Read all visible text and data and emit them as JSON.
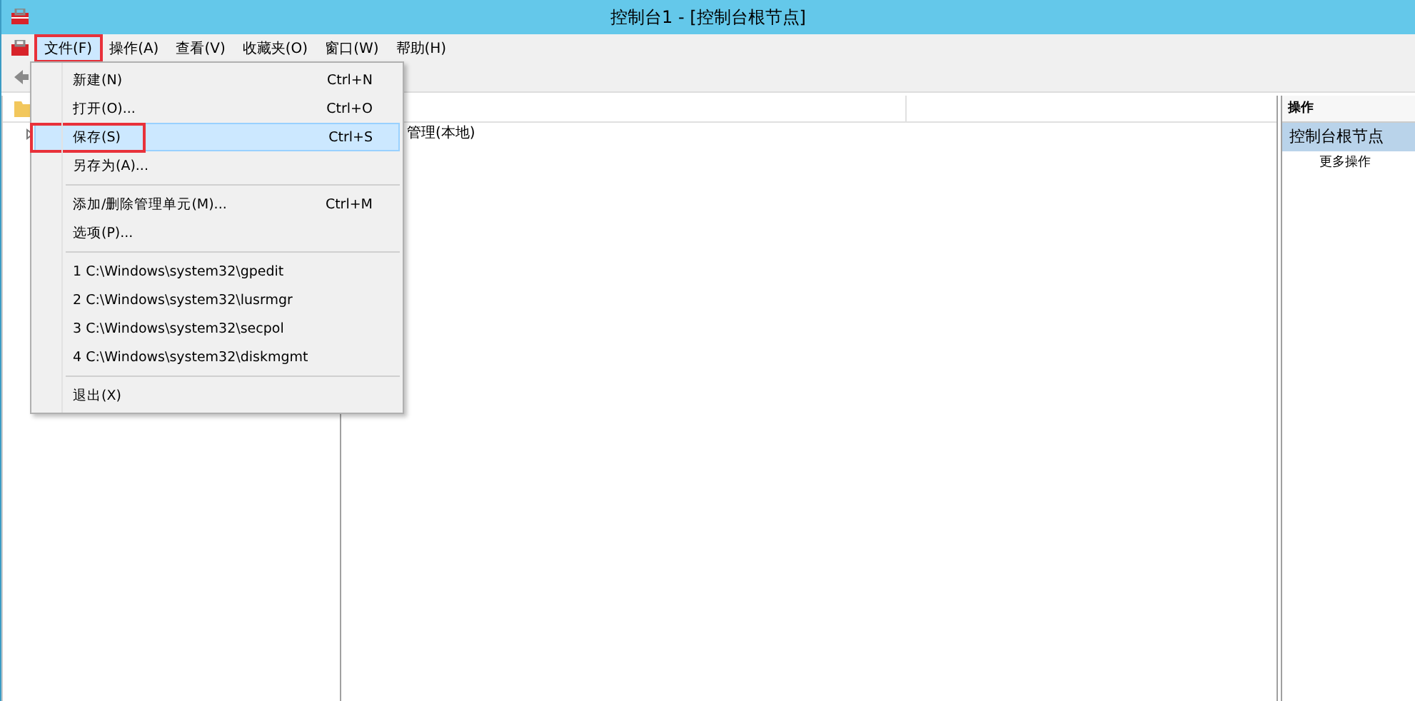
{
  "window": {
    "title": "控制台1 - [控制台根节点]"
  },
  "menu_bar": [
    {
      "label": "文件(F)",
      "selected": true,
      "outlined": true
    },
    {
      "label": "操作(A)",
      "selected": false,
      "outlined": false
    },
    {
      "label": "查看(V)",
      "selected": false,
      "outlined": false
    },
    {
      "label": "收藏夹(O)",
      "selected": false,
      "outlined": false
    },
    {
      "label": "窗口(W)",
      "selected": false,
      "outlined": false
    },
    {
      "label": "帮助(H)",
      "selected": false,
      "outlined": false
    }
  ],
  "file_menu": [
    {
      "kind": "item",
      "label": "新建(N)",
      "shortcut": "Ctrl+N",
      "selected": false,
      "outlined": false
    },
    {
      "kind": "item",
      "label": "打开(O)...",
      "shortcut": "Ctrl+O",
      "selected": false,
      "outlined": false
    },
    {
      "kind": "item",
      "label": "保存(S)",
      "shortcut": "Ctrl+S",
      "selected": true,
      "outlined": true
    },
    {
      "kind": "item",
      "label": "另存为(A)...",
      "selected": false,
      "outlined": false
    },
    {
      "kind": "separator"
    },
    {
      "kind": "item",
      "label": "添加/删除管理单元(M)...",
      "shortcut": "Ctrl+M",
      "selected": false,
      "outlined": false
    },
    {
      "kind": "item",
      "label": "选项(P)...",
      "selected": false,
      "outlined": false
    },
    {
      "kind": "separator"
    },
    {
      "kind": "item",
      "label": "1 C:\\Windows\\system32\\gpedit",
      "selected": false,
      "outlined": false
    },
    {
      "kind": "item",
      "label": "2 C:\\Windows\\system32\\lusrmgr",
      "selected": false,
      "outlined": false
    },
    {
      "kind": "item",
      "label": "3 C:\\Windows\\system32\\secpol",
      "selected": false,
      "outlined": false
    },
    {
      "kind": "item",
      "label": "4 C:\\Windows\\system32\\diskmgmt",
      "selected": false,
      "outlined": false
    },
    {
      "kind": "separator"
    },
    {
      "kind": "item",
      "label": "退出(X)",
      "selected": false,
      "outlined": false
    }
  ],
  "center": {
    "rows": [
      "管理(本地)"
    ]
  },
  "actions": {
    "header": "操作",
    "items": [
      {
        "label": "控制台根节点",
        "selected": true,
        "children": [
          {
            "label": "更多操作"
          }
        ]
      }
    ]
  }
}
